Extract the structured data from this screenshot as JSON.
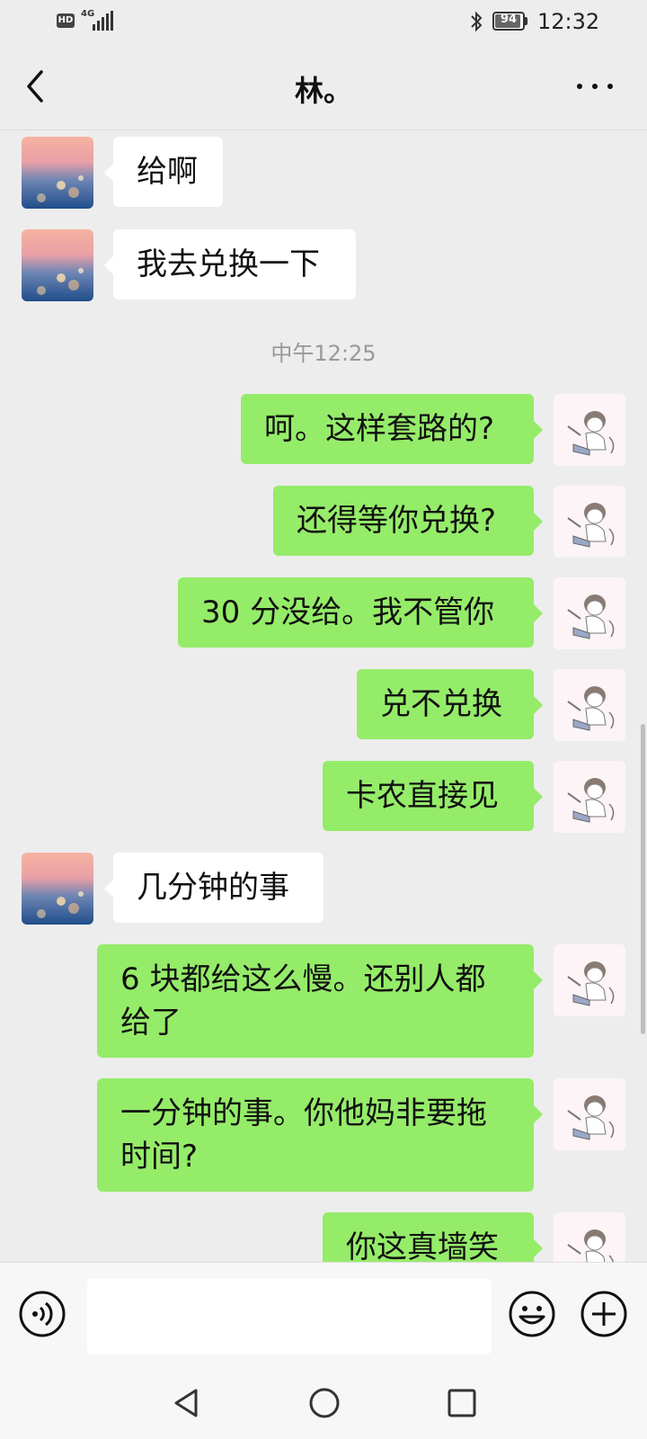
{
  "status_bar": {
    "hd": "HD",
    "network": "4G",
    "battery": "94",
    "battery_level": 0.94,
    "time": "12:32"
  },
  "header": {
    "title": "林。",
    "back_icon": "chevron-left-icon",
    "more_icon": "more-dots-icon"
  },
  "messages": [
    {
      "side": "in",
      "text": "给啊"
    },
    {
      "side": "in",
      "text": "我去兑换一下"
    },
    {
      "timestamp": "中午12:25"
    },
    {
      "side": "out",
      "text": "呵。这样套路的?"
    },
    {
      "side": "out",
      "text": "还得等你兑换?"
    },
    {
      "side": "out",
      "text": "30 分没给。我不管你"
    },
    {
      "side": "out",
      "text": "兑不兑换"
    },
    {
      "side": "out",
      "text": "卡农直接见"
    },
    {
      "side": "in",
      "text": "几分钟的事"
    },
    {
      "side": "out",
      "text": "6 块都给这么慢。还别人都给了"
    },
    {
      "side": "out",
      "text": "一分钟的事。你他妈非要拖时间?"
    },
    {
      "side": "out",
      "text": "你这真墙笑"
    }
  ],
  "input_bar": {
    "voice_icon": "voice-icon",
    "placeholder": "",
    "emoji_icon": "emoji-icon",
    "plus_icon": "plus-icon"
  },
  "nav_bar": {
    "back_icon": "triangle-back-icon",
    "home_icon": "circle-home-icon",
    "recents_icon": "square-recents-icon"
  },
  "colors": {
    "outgoing_bubble": "#95ec69",
    "incoming_bubble": "#ffffff",
    "background": "#ededed"
  }
}
